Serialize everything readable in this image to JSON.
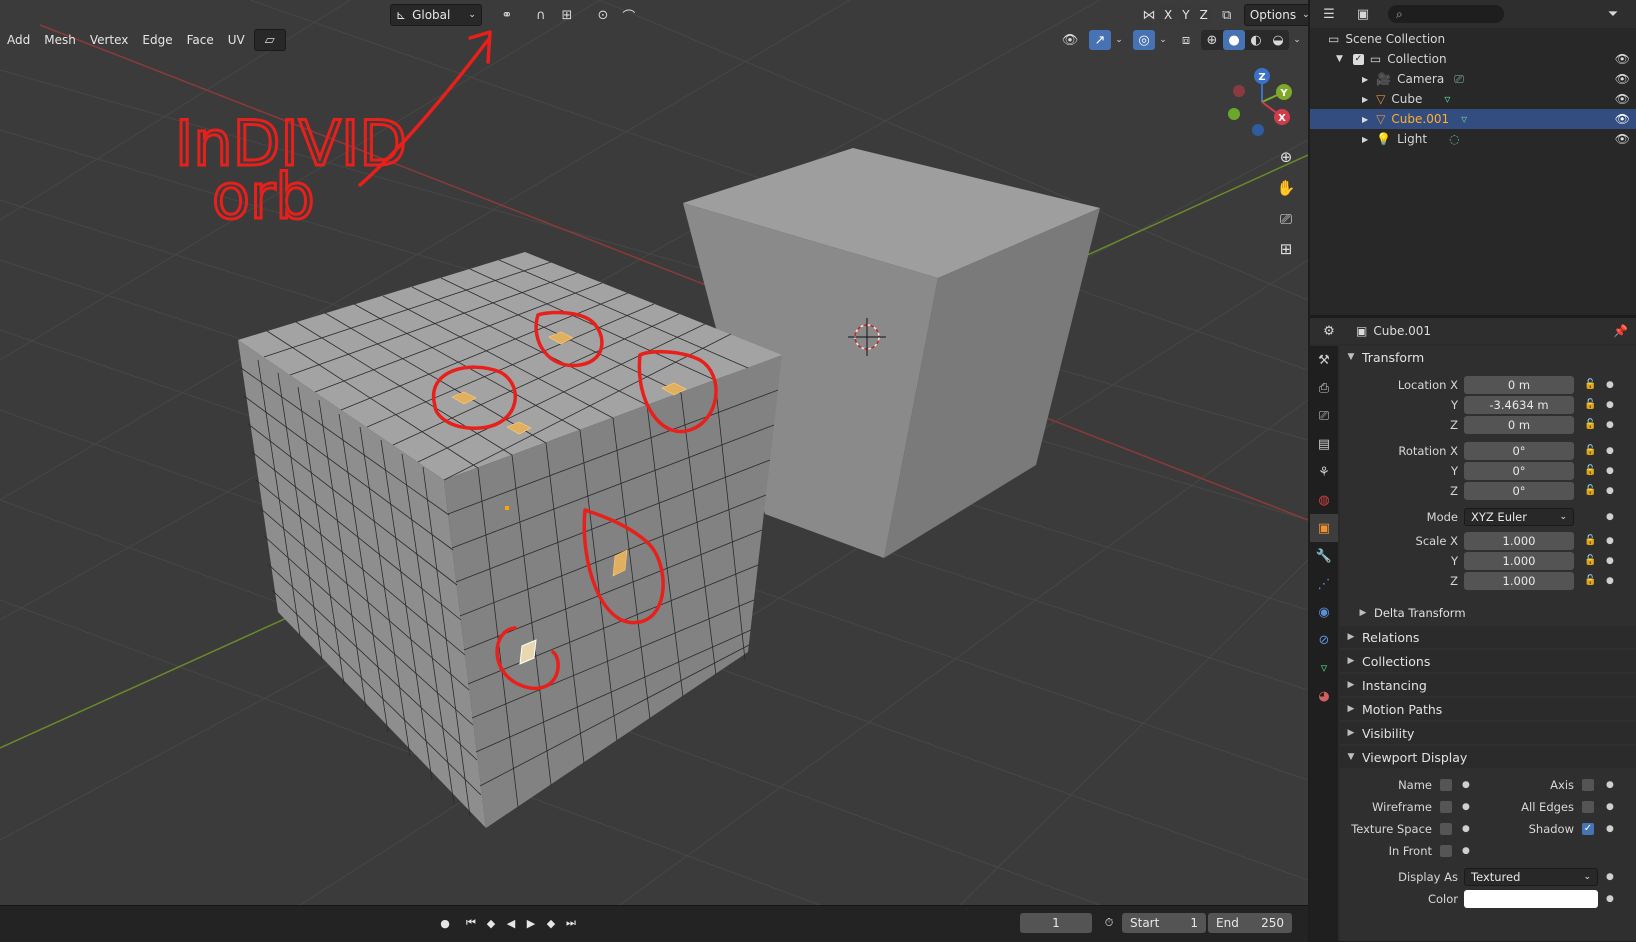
{
  "viewport_header": {
    "transform_orientation": "Global",
    "axes": [
      "X",
      "Y",
      "Z"
    ],
    "options_label": "Options"
  },
  "edit_menu": [
    "Add",
    "Mesh",
    "Vertex",
    "Edge",
    "Face",
    "UV"
  ],
  "annotation": {
    "line1": "InDIVID",
    "line2": "orb"
  },
  "nav_gizmo": {
    "x": "X",
    "y": "Y",
    "z": "Z"
  },
  "timeline": {
    "current_frame": "1",
    "start_label": "Start",
    "start_value": "1",
    "end_label": "End",
    "end_value": "250"
  },
  "outliner": {
    "root": "Scene Collection",
    "collection": "Collection",
    "items": [
      {
        "name": "Camera"
      },
      {
        "name": "Cube"
      },
      {
        "name": "Cube.001"
      },
      {
        "name": "Light"
      }
    ]
  },
  "properties": {
    "object_name": "Cube.001",
    "transform_label": "Transform",
    "location": {
      "label": "Location X",
      "x": "0 m",
      "y": "-3.4634 m",
      "z": "0 m"
    },
    "rotation": {
      "label": "Rotation X",
      "x": "0°",
      "y": "0°",
      "z": "0°"
    },
    "mode": {
      "label": "Mode",
      "value": "XYZ Euler"
    },
    "scale": {
      "label": "Scale X",
      "x": "1.000",
      "y": "1.000",
      "z": "1.000"
    },
    "axis_y": "Y",
    "axis_z": "Z",
    "subpanels": [
      "Delta Transform"
    ],
    "panels": [
      "Relations",
      "Collections",
      "Instancing",
      "Motion Paths",
      "Visibility"
    ],
    "viewport_display": {
      "label": "Viewport Display",
      "name": "Name",
      "axis": "Axis",
      "wireframe": "Wireframe",
      "all_edges": "All Edges",
      "texture_space": "Texture Space",
      "shadow": "Shadow",
      "in_front": "In Front",
      "display_as_label": "Display As",
      "display_as_value": "Textured",
      "color_label": "Color"
    }
  },
  "colors": {
    "accent": "#4772b3",
    "selection_orange": "#ffaf29",
    "annotation_red": "#e8201b"
  }
}
